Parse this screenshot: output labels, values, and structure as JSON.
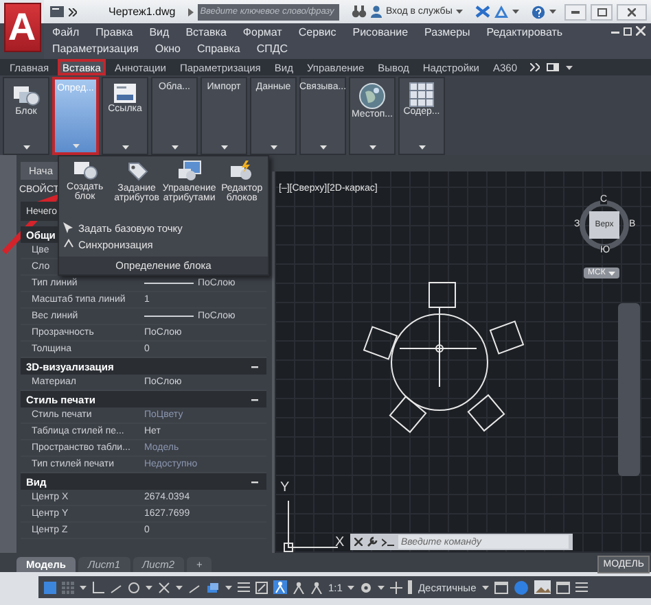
{
  "title_bar": {
    "logo": "A",
    "document": "Чертеж1.dwg",
    "search": {
      "placeholder": "Введите ключевое слово/фразу"
    },
    "sign_in": "Вход в службы"
  },
  "menu": {
    "items": [
      "Файл",
      "Правка",
      "Вид",
      "Вставка",
      "Формат",
      "Сервис",
      "Рисование",
      "Размеры",
      "Редактировать",
      "Параметризация",
      "Окно",
      "Справка",
      "СПДС"
    ]
  },
  "ribbon": {
    "tabs": [
      {
        "label": "Главная",
        "selected": false
      },
      {
        "label": "Вставка",
        "selected": true
      },
      {
        "label": "Аннотации",
        "selected": false
      },
      {
        "label": "Параметризация",
        "selected": false
      },
      {
        "label": "Вид",
        "selected": false
      },
      {
        "label": "Управление",
        "selected": false
      },
      {
        "label": "Вывод",
        "selected": false
      },
      {
        "label": "Надстройки",
        "selected": false
      },
      {
        "label": "A360",
        "selected": false
      }
    ],
    "panels": [
      {
        "label": "Блок",
        "kind": "large",
        "selected": false
      },
      {
        "label": "Опред...",
        "kind": "collapsed",
        "selected": true
      },
      {
        "label": "Ссылка",
        "kind": "large",
        "selected": false
      },
      {
        "label": "Обла...",
        "kind": "collapsed",
        "selected": false
      },
      {
        "label": "Импорт",
        "kind": "collapsed",
        "selected": false
      },
      {
        "label": "Данные",
        "kind": "collapsed",
        "selected": false
      },
      {
        "label": "Связыва...",
        "kind": "collapsed",
        "selected": false
      },
      {
        "label": "Местоп...",
        "kind": "large",
        "selected": false
      },
      {
        "label": "Содер...",
        "kind": "large",
        "selected": false
      }
    ]
  },
  "block_definition_menu": {
    "tools": [
      {
        "label": "Создать блок"
      },
      {
        "label": "Задание атрибутов"
      },
      {
        "label": "Управление атрибутами"
      },
      {
        "label": "Редактор блоков"
      }
    ],
    "commands": [
      "Задать базовую точку",
      "Синхронизация"
    ],
    "footer": "Определение блока"
  },
  "palette": {
    "file_tab": "Нача",
    "title": "СВОЙСТ",
    "selection": "Нечего",
    "sections": [
      {
        "title": "Общи",
        "rows": [
          {
            "label": "Цве"
          },
          {
            "label": "Сло"
          },
          {
            "label": "Тип линий",
            "value": "ПоСлою",
            "kind": "line"
          },
          {
            "label": "Масштаб типа линий",
            "value": "1",
            "kind": "text"
          },
          {
            "label": "Вес линий",
            "value": "ПоСлою",
            "kind": "line"
          },
          {
            "label": "Прозрачность",
            "value": "ПоСлою",
            "kind": "text"
          },
          {
            "label": "Толщина",
            "value": "0",
            "kind": "text"
          }
        ]
      },
      {
        "title": "3D-визуализация",
        "rows": [
          {
            "label": "Материал",
            "value": "ПоСлою",
            "kind": "text"
          }
        ]
      },
      {
        "title": "Стиль печати",
        "rows": [
          {
            "label": "Стиль печати",
            "value": "ПоЦвету",
            "kind": "text",
            "disabled": true
          },
          {
            "label": "Таблица стилей пе...",
            "value": "Нет",
            "kind": "text",
            "disabled": false
          },
          {
            "label": "Пространство табли...",
            "value": "Модель",
            "kind": "text",
            "disabled": true
          },
          {
            "label": "Тип стилей печати",
            "value": "Недоступно",
            "kind": "text",
            "disabled": true
          }
        ]
      },
      {
        "title": "Вид",
        "rows": [
          {
            "label": "Центр X",
            "value": "2674.0394",
            "kind": "text"
          },
          {
            "label": "Центр Y",
            "value": "1627.7699",
            "kind": "text"
          },
          {
            "label": "Центр Z",
            "value": "0",
            "kind": "text"
          }
        ]
      }
    ]
  },
  "viewport": {
    "label": "[–][Сверху][2D-каркас]",
    "viewcube": {
      "north": "С",
      "west": "З",
      "east": "В",
      "south": "Ю",
      "face": "Верх",
      "ucs": "МСК"
    },
    "axes": {
      "y": "Y",
      "x": "X"
    },
    "command": {
      "placeholder": "Введите команду"
    }
  },
  "layout_tabs": [
    {
      "label": "Модель",
      "selected": true
    },
    {
      "label": "Лист1",
      "selected": false
    },
    {
      "label": "Лист2",
      "selected": false
    }
  ],
  "add_tab": "+",
  "space": "МОДЕЛЬ",
  "status_bar": {
    "scale": "1:1",
    "units": "Десятичные"
  }
}
